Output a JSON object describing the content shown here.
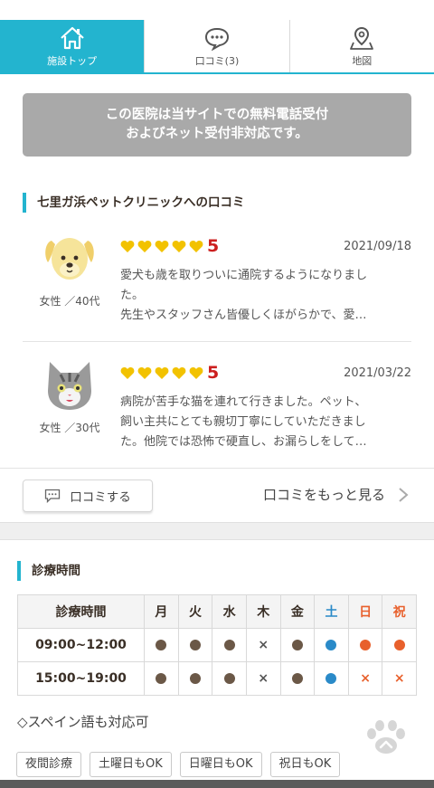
{
  "tabs": [
    {
      "label": "施設トップ",
      "icon": "home-icon",
      "active": true
    },
    {
      "label": "口コミ(3)",
      "icon": "chat-bubble-icon",
      "active": false
    },
    {
      "label": "地図",
      "icon": "map-pin-icon",
      "active": false
    }
  ],
  "notice": {
    "line1": "この医院は当サイトでの無料電話受付",
    "line2": "およびネット受付非対応です。"
  },
  "reviews_section": {
    "title": "七里ガ浜ペットクリニックへの口コミ",
    "reviews": [
      {
        "avatar": "dog-avatar-icon",
        "reviewer": "女性 ／40代",
        "rating": 5,
        "score_text": "5",
        "date": "2021/09/18",
        "lines": [
          "愛犬も歳を取りついに通院するようになりまし",
          "た。",
          "先生やスタッフさん皆優しくほがらかで、愛…"
        ]
      },
      {
        "avatar": "cat-avatar-icon",
        "reviewer": "女性 ／30代",
        "rating": 5,
        "score_text": "5",
        "date": "2021/03/22",
        "lines": [
          "病院が苦手な猫を連れて行きました。ペット、",
          "飼い主共にとても親切丁寧にしていただきまし",
          "た。他院では恐怖で硬直し、お漏らしをして…"
        ]
      }
    ],
    "write_button": "口コミする",
    "more_link": "口コミをもっと見る"
  },
  "hours_section": {
    "title": "診療時間",
    "header": [
      "診療時間",
      "月",
      "火",
      "水",
      "木",
      "金",
      "土",
      "日",
      "祝"
    ],
    "header_colors": [
      "#3a2f26",
      "#3a2f26",
      "#3a2f26",
      "#3a2f26",
      "#3a2f26",
      "#3a2f26",
      "#2a8ac8",
      "#e8602c",
      "#e8602c"
    ],
    "rows": [
      {
        "time": "09:00~12:00",
        "cells": [
          "brown-dot",
          "brown-dot",
          "brown-dot",
          "x",
          "brown-dot",
          "blue-dot",
          "orange-dot",
          "orange-dot"
        ]
      },
      {
        "time": "15:00~19:00",
        "cells": [
          "brown-dot",
          "brown-dot",
          "brown-dot",
          "x",
          "brown-dot",
          "blue-dot",
          "orange-x",
          "orange-x"
        ]
      }
    ],
    "x_mark": "×",
    "note": "◇スペイン語も対応可",
    "tags": [
      "夜間診療",
      "土曜日もOK",
      "日曜日もOK",
      "祝日もOK"
    ]
  },
  "colors": {
    "accent": "#23b4cf",
    "brown_dot": "#6b5847",
    "blue_dot": "#2a8ac8",
    "orange_dot": "#e8602c",
    "heart": "#f2c200",
    "score": "#cc1f1f"
  }
}
